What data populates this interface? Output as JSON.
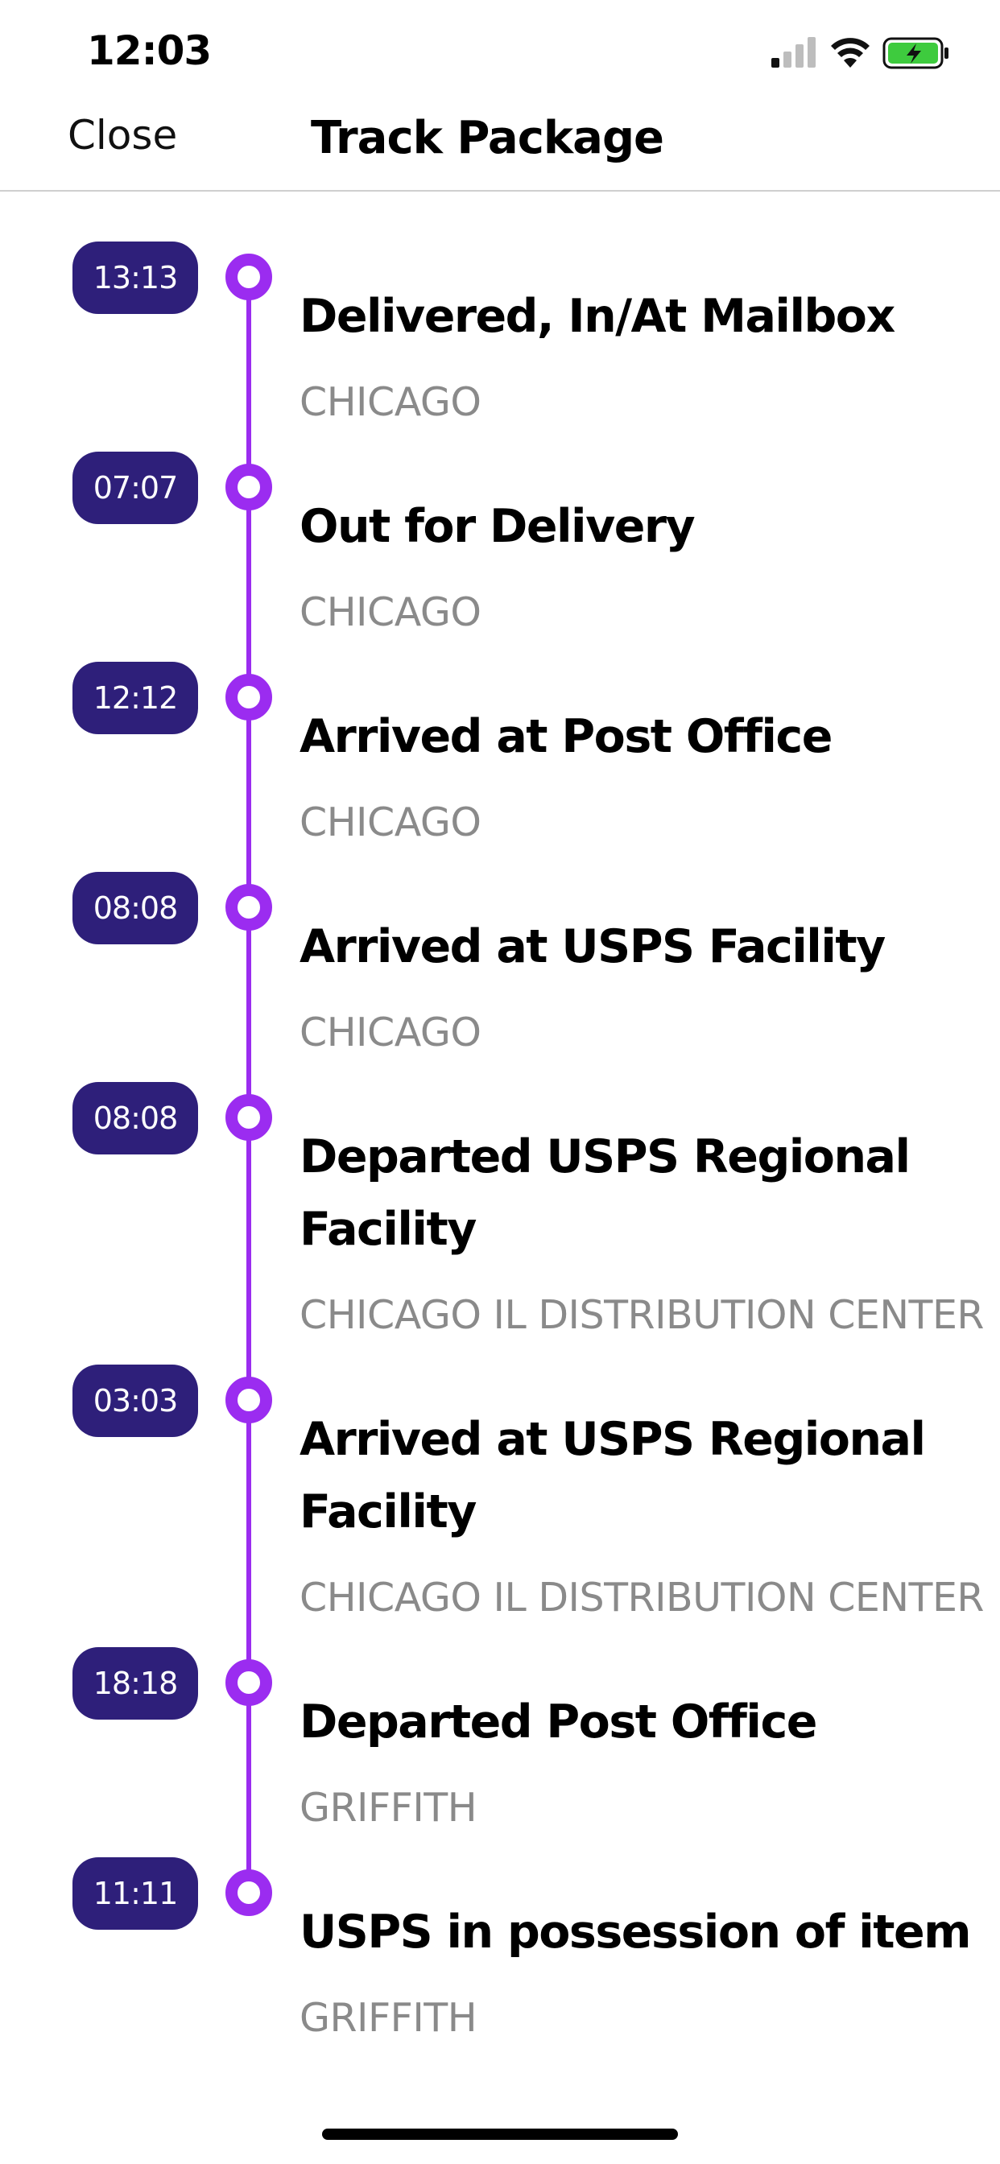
{
  "status_bar": {
    "time": "12:03",
    "icons": [
      "cellular-signal-icon",
      "wifi-icon",
      "battery-charging-icon"
    ],
    "battery_color": "#3ecb3e"
  },
  "nav": {
    "close_label": "Close",
    "title": "Track Package"
  },
  "colors": {
    "accent": "#9b2cf0",
    "badge_bg": "#2e1f7a",
    "location_text": "#8a8a8a"
  },
  "events": [
    {
      "time": "13:13",
      "title": "Delivered, In/At Mailbox",
      "location": "CHICAGO"
    },
    {
      "time": "07:07",
      "title": "Out for Delivery",
      "location": "CHICAGO"
    },
    {
      "time": "12:12",
      "title": "Arrived at Post Office",
      "location": "CHICAGO"
    },
    {
      "time": "08:08",
      "title": "Arrived at USPS Facility",
      "location": "CHICAGO"
    },
    {
      "time": "08:08",
      "title": "Departed USPS Regional Facility",
      "location": "CHICAGO IL DISTRIBUTION CENTER"
    },
    {
      "time": "03:03",
      "title": "Arrived at USPS Regional Facility",
      "location": "CHICAGO IL DISTRIBUTION CENTER"
    },
    {
      "time": "18:18",
      "title": "Departed Post Office",
      "location": "GRIFFITH"
    },
    {
      "time": "11:11",
      "title": "USPS in possession of item",
      "location": "GRIFFITH"
    }
  ]
}
